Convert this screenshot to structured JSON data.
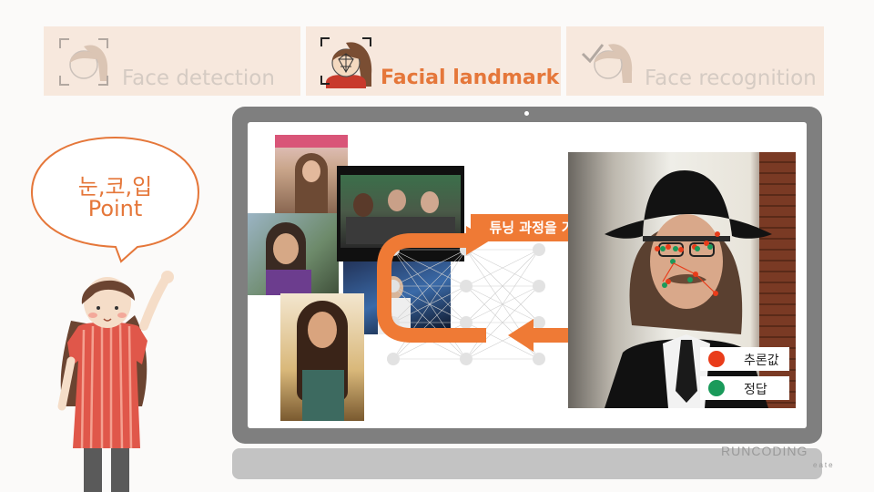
{
  "tabs": [
    {
      "label": "Face detection",
      "active": false
    },
    {
      "label": "Facial landmark",
      "active": true
    },
    {
      "label": "Face recognition",
      "active": false
    }
  ],
  "speech": {
    "line1": "눈,코,입",
    "line2": "Point"
  },
  "tuning_label": "튜닝 과정을 거침",
  "legend": {
    "inferred": "추론값",
    "answer": "정답"
  },
  "brand": {
    "name": "RUNCODING",
    "tagline": "eate"
  },
  "colors": {
    "accent": "#ef7a35",
    "inferred": "#e93c1a",
    "answer": "#1a9a5a"
  }
}
